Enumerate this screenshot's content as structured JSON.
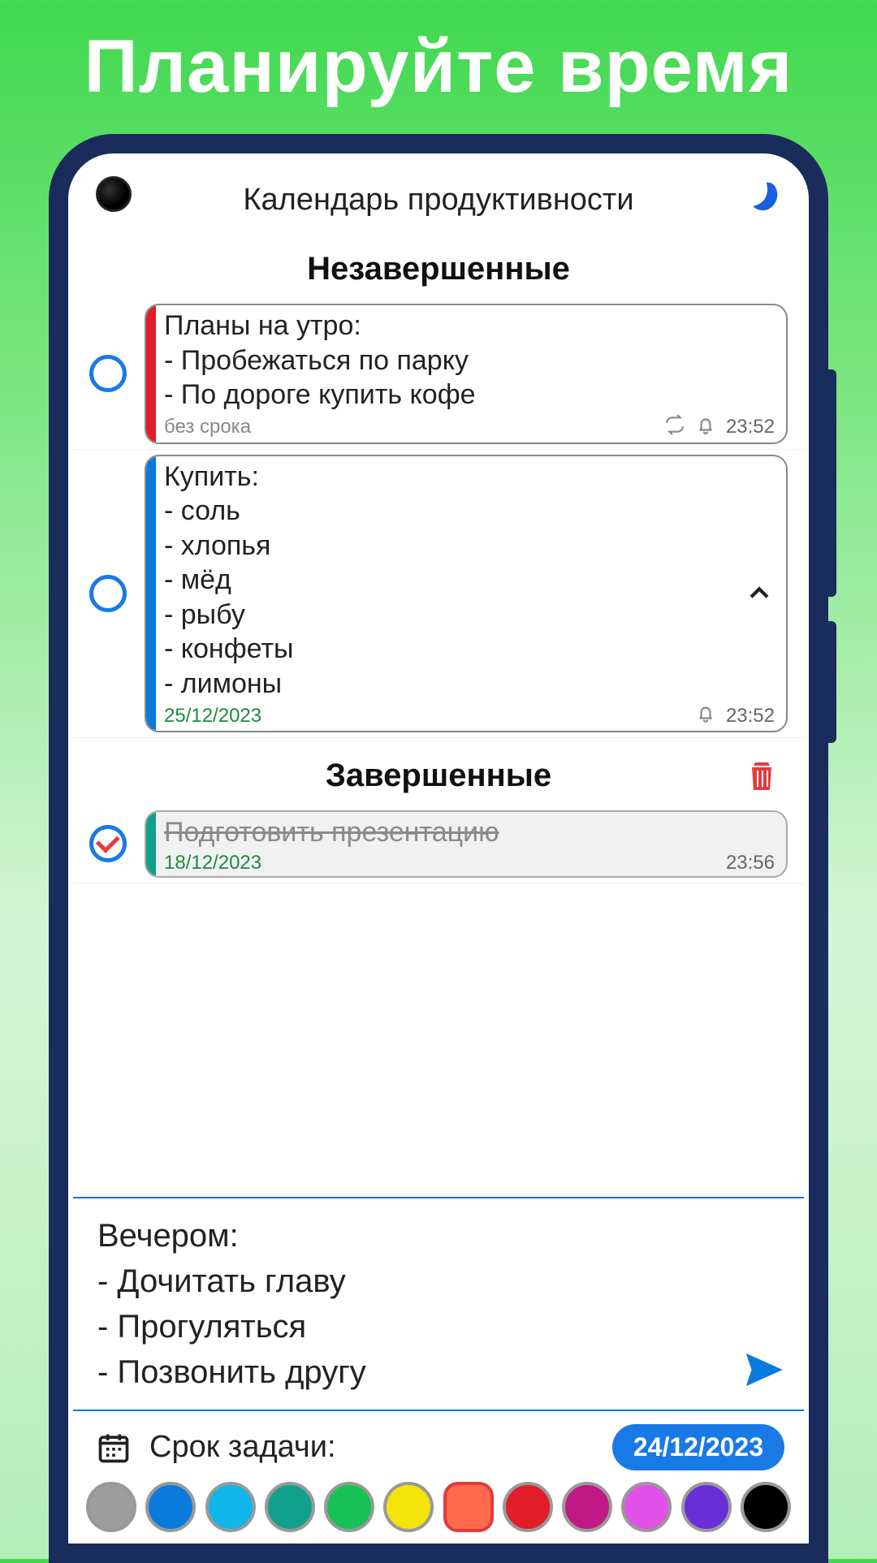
{
  "promo_title": "Планируйте время",
  "app_title": "Календарь продуктивности",
  "sections": {
    "pending": "Незавершенные",
    "done": "Завершенные"
  },
  "tasks_pending": [
    {
      "color": "#e21d2a",
      "text": "Планы на утро:\n- Пробежаться по парку\n- По дороге купить кофе",
      "deadline": "без срока",
      "deadline_none": true,
      "repeat": true,
      "alarm": true,
      "time": "23:52",
      "collapse": false
    },
    {
      "color": "#0a7adc",
      "text": "Купить:\n- соль\n- хлопья\n- мёд\n- рыбу\n- конфеты\n- лимоны",
      "deadline": "25/12/2023",
      "deadline_none": false,
      "repeat": false,
      "alarm": true,
      "time": "23:52",
      "collapse": true
    }
  ],
  "tasks_done": [
    {
      "color": "#11a18b",
      "text": "Подготовить презентацию",
      "deadline": "18/12/2023",
      "time": "23:56"
    }
  ],
  "editor_text": "Вечером:\n- Дочитать главу\n- Прогуляться\n- Позвонить другу",
  "deadline_label": "Срок задачи:",
  "deadline_value": "24/12/2023",
  "palette": [
    {
      "c": "#9d9d9d",
      "sel": false
    },
    {
      "c": "#0a7adc",
      "sel": false
    },
    {
      "c": "#10b6e8",
      "sel": false
    },
    {
      "c": "#11a18b",
      "sel": false
    },
    {
      "c": "#17c255",
      "sel": false
    },
    {
      "c": "#f5e40a",
      "sel": false
    },
    {
      "c": "#ff6a4d",
      "sel": true
    },
    {
      "c": "#e21d2a",
      "sel": false
    },
    {
      "c": "#c01884",
      "sel": false
    },
    {
      "c": "#e251e8",
      "sel": false
    },
    {
      "c": "#6a2ed6",
      "sel": false
    },
    {
      "c": "#000000",
      "sel": false
    }
  ]
}
